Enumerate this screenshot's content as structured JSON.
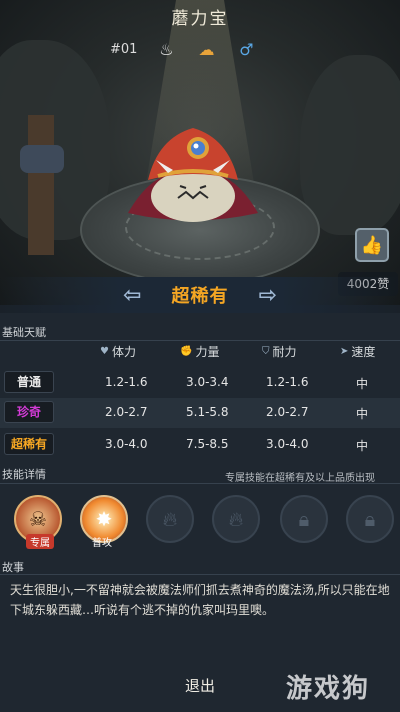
{
  "pet": {
    "name": "蘑力宝",
    "id": "#01",
    "rarity": "超稀有",
    "likes": "4002赞"
  },
  "talent": {
    "section_title": "基础天赋",
    "headers": [
      "体力",
      "力量",
      "耐力",
      "速度"
    ],
    "rows": [
      {
        "tier": "普通",
        "tier_color": "#e8e8e8",
        "hp": "1.2-1.6",
        "atk": "3.0-3.4",
        "def": "1.2-1.6",
        "spd": "中"
      },
      {
        "tier": "珍奇",
        "tier_color": "#d23bd6",
        "hp": "2.0-2.7",
        "atk": "5.1-5.8",
        "def": "2.0-2.7",
        "spd": "中"
      },
      {
        "tier": "超稀有",
        "tier_color": "#f5a623",
        "hp": "3.0-4.0",
        "atk": "7.5-8.5",
        "def": "3.0-4.0",
        "spd": "中"
      }
    ]
  },
  "skills": {
    "section_title": "技能详情",
    "note": "专属技能在超稀有及以上品质出现",
    "items": [
      {
        "label": "专属",
        "state": "active"
      },
      {
        "label": "普攻",
        "state": "active"
      },
      {
        "label": "",
        "state": "locked-fire"
      },
      {
        "label": "",
        "state": "locked-fire"
      },
      {
        "label": "",
        "state": "locked"
      },
      {
        "label": "",
        "state": "locked"
      }
    ]
  },
  "story": {
    "section_title": "故事",
    "text": "天生很胆小,一不留神就会被魔法师们抓去煮神奇的魔法汤,所以只能在地下城东躲西藏…听说有个逃不掉的仇家叫玛里噢。"
  },
  "footer": {
    "back_label": "退出",
    "watermark": "游戏狗"
  },
  "icons": {
    "gender": "male-icon",
    "diet": "bowl-icon",
    "element": "terrain-icon",
    "like": "thumbs-up-icon"
  }
}
